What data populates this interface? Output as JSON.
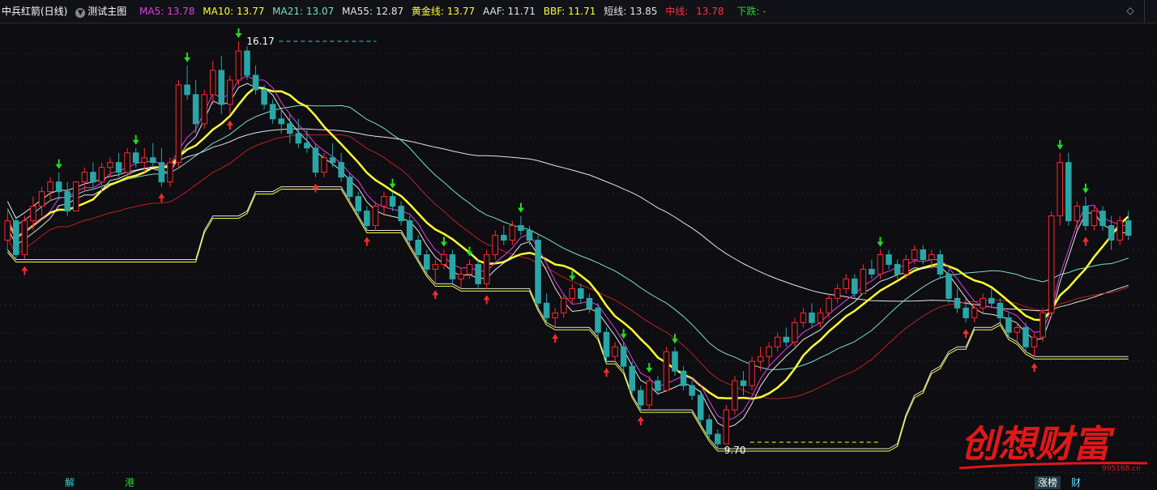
{
  "header": {
    "stock": "中兵红箭(日线)",
    "template": "测试主图",
    "ma5": "MA5: 13.78",
    "ma10": "MA10: 13.77",
    "ma21": "MA21: 13.07",
    "ma55": "MA55: 12.87",
    "gold": "黄金线: 13.77",
    "aaf": "AAF: 11.71",
    "bbf": "BBF: 11.71",
    "short": "短线: 13.85",
    "mid_label": "中线:",
    "mid_val": "13.78",
    "fall": "下跌: -"
  },
  "footer": {
    "left1": "解",
    "left2": "港",
    "tab1": "涨榜",
    "tab2": "财"
  },
  "logo": {
    "text": "创想财富",
    "url": "995168.cn"
  },
  "colors": {
    "bg": "#0d0d12",
    "up": "#ff2a2a",
    "down": "#2aa6a6",
    "yellow": "#ffff33",
    "white": "#e6e6e6",
    "aqua": "#7fe0c0",
    "magenta": "#e040e0",
    "darkred": "#c02020",
    "green": "#22dd22",
    "orange": "#ff9933",
    "pink": "#ff3388",
    "cyanlabel": "#44cccc"
  },
  "chart_data": {
    "type": "candlestick",
    "price_labels": {
      "high": "16.17",
      "low": "9.70"
    },
    "candles": [
      [
        14.0,
        14.6,
        13.8,
        14.4
      ],
      [
        14.4,
        14.5,
        13.6,
        13.7
      ],
      [
        13.7,
        14.5,
        13.6,
        14.4
      ],
      [
        14.4,
        14.9,
        14.2,
        14.7
      ],
      [
        14.7,
        15.1,
        14.5,
        15.0
      ],
      [
        15.0,
        15.3,
        14.8,
        15.2
      ],
      [
        15.2,
        15.4,
        14.9,
        15.0
      ],
      [
        15.0,
        15.2,
        14.5,
        14.6
      ],
      [
        14.6,
        15.2,
        14.6,
        15.2
      ],
      [
        15.2,
        15.5,
        15.0,
        15.4
      ],
      [
        15.4,
        15.6,
        15.1,
        15.2
      ],
      [
        15.2,
        15.6,
        15.0,
        15.5
      ],
      [
        15.5,
        15.7,
        15.3,
        15.6
      ],
      [
        15.6,
        15.8,
        15.3,
        15.4
      ],
      [
        15.4,
        15.9,
        15.3,
        15.8
      ],
      [
        15.8,
        15.9,
        15.5,
        15.6
      ],
      [
        15.6,
        15.9,
        15.4,
        15.7
      ],
      [
        15.7,
        16.0,
        15.5,
        15.6
      ],
      [
        15.6,
        15.9,
        15.1,
        15.2
      ],
      [
        15.2,
        15.7,
        15.1,
        15.6
      ],
      [
        15.6,
        17.3,
        15.5,
        17.2
      ],
      [
        17.2,
        17.6,
        16.9,
        17.0
      ],
      [
        17.0,
        17.3,
        16.2,
        16.4
      ],
      [
        16.4,
        17.1,
        16.3,
        17.0
      ],
      [
        17.0,
        17.7,
        16.8,
        17.5
      ],
      [
        17.5,
        17.8,
        16.6,
        16.8
      ],
      [
        16.8,
        17.4,
        16.6,
        17.3
      ],
      [
        17.3,
        18.1,
        17.2,
        17.9
      ],
      [
        17.9,
        18.0,
        17.3,
        17.4
      ],
      [
        17.4,
        17.6,
        17.0,
        17.1
      ],
      [
        17.1,
        17.2,
        16.7,
        16.8
      ],
      [
        16.8,
        16.9,
        16.4,
        16.5
      ],
      [
        16.5,
        16.7,
        16.2,
        16.4
      ],
      [
        16.4,
        16.6,
        16.0,
        16.2
      ],
      [
        16.2,
        16.5,
        15.9,
        16.0
      ],
      [
        16.0,
        16.3,
        15.8,
        15.9
      ],
      [
        15.9,
        16.0,
        15.3,
        15.4
      ],
      [
        15.4,
        15.8,
        15.3,
        15.7
      ],
      [
        15.7,
        16.0,
        15.5,
        15.6
      ],
      [
        15.6,
        15.8,
        15.2,
        15.3
      ],
      [
        15.3,
        15.4,
        14.8,
        14.9
      ],
      [
        14.9,
        15.0,
        14.5,
        14.6
      ],
      [
        14.6,
        14.7,
        14.2,
        14.3
      ],
      [
        14.3,
        14.8,
        14.2,
        14.7
      ],
      [
        14.7,
        15.0,
        14.5,
        14.9
      ],
      [
        14.9,
        15.0,
        14.6,
        14.7
      ],
      [
        14.7,
        14.8,
        14.3,
        14.4
      ],
      [
        14.4,
        14.5,
        13.9,
        14.0
      ],
      [
        14.0,
        14.1,
        13.6,
        13.7
      ],
      [
        13.7,
        13.8,
        13.3,
        13.4
      ],
      [
        13.4,
        13.6,
        13.1,
        13.5
      ],
      [
        13.5,
        13.8,
        13.4,
        13.7
      ],
      [
        13.7,
        13.8,
        13.1,
        13.2
      ],
      [
        13.2,
        13.4,
        13.0,
        13.3
      ],
      [
        13.3,
        13.6,
        13.2,
        13.5
      ],
      [
        13.5,
        13.6,
        13.0,
        13.1
      ],
      [
        13.1,
        13.8,
        13.0,
        13.7
      ],
      [
        13.7,
        14.2,
        13.6,
        14.1
      ],
      [
        14.1,
        14.3,
        13.9,
        14.0
      ],
      [
        14.0,
        14.4,
        13.9,
        14.3
      ],
      [
        14.3,
        14.5,
        14.1,
        14.2
      ],
      [
        14.2,
        14.3,
        13.9,
        14.0
      ],
      [
        14.0,
        14.1,
        12.6,
        12.7
      ],
      [
        12.7,
        12.9,
        12.3,
        12.4
      ],
      [
        12.4,
        12.6,
        12.2,
        12.5
      ],
      [
        12.5,
        12.9,
        12.4,
        12.8
      ],
      [
        12.8,
        13.1,
        12.7,
        13.0
      ],
      [
        13.0,
        13.1,
        12.7,
        12.8
      ],
      [
        12.8,
        12.9,
        12.5,
        12.6
      ],
      [
        12.6,
        12.7,
        12.0,
        12.1
      ],
      [
        12.1,
        12.2,
        11.5,
        11.6
      ],
      [
        11.6,
        11.9,
        11.5,
        11.8
      ],
      [
        11.8,
        11.9,
        11.3,
        11.4
      ],
      [
        11.4,
        11.5,
        10.8,
        10.9
      ],
      [
        10.9,
        11.0,
        10.5,
        10.6
      ],
      [
        10.6,
        11.2,
        10.5,
        11.1
      ],
      [
        11.1,
        11.2,
        10.8,
        10.9
      ],
      [
        10.9,
        11.8,
        10.9,
        11.7
      ],
      [
        11.7,
        11.8,
        11.2,
        11.3
      ],
      [
        11.3,
        11.4,
        10.9,
        11.0
      ],
      [
        11.0,
        11.1,
        10.7,
        10.8
      ],
      [
        10.8,
        10.9,
        10.2,
        10.3
      ],
      [
        10.3,
        10.4,
        9.9,
        10.0
      ],
      [
        10.0,
        10.1,
        9.7,
        9.8
      ],
      [
        9.8,
        10.6,
        9.8,
        10.5
      ],
      [
        10.5,
        11.2,
        10.4,
        11.1
      ],
      [
        11.1,
        11.3,
        10.8,
        11.0
      ],
      [
        11.0,
        11.6,
        10.9,
        11.5
      ],
      [
        11.5,
        11.8,
        11.3,
        11.6
      ],
      [
        11.6,
        11.9,
        11.4,
        11.8
      ],
      [
        11.8,
        12.1,
        11.7,
        12.0
      ],
      [
        12.0,
        12.2,
        11.8,
        11.9
      ],
      [
        11.9,
        12.4,
        11.8,
        12.3
      ],
      [
        12.3,
        12.6,
        12.2,
        12.5
      ],
      [
        12.5,
        12.7,
        12.2,
        12.3
      ],
      [
        12.3,
        12.6,
        12.2,
        12.5
      ],
      [
        12.5,
        12.9,
        12.4,
        12.8
      ],
      [
        12.8,
        13.1,
        12.7,
        13.0
      ],
      [
        13.0,
        13.3,
        12.9,
        13.2
      ],
      [
        13.2,
        13.3,
        12.8,
        12.9
      ],
      [
        12.9,
        13.5,
        12.9,
        13.4
      ],
      [
        13.4,
        13.6,
        13.2,
        13.3
      ],
      [
        13.3,
        13.8,
        13.2,
        13.7
      ],
      [
        13.7,
        13.8,
        13.4,
        13.5
      ],
      [
        13.5,
        13.6,
        13.2,
        13.3
      ],
      [
        13.3,
        13.7,
        13.2,
        13.6
      ],
      [
        13.6,
        13.9,
        13.5,
        13.8
      ],
      [
        13.8,
        13.9,
        13.5,
        13.6
      ],
      [
        13.6,
        13.8,
        13.4,
        13.7
      ],
      [
        13.7,
        13.8,
        13.2,
        13.3
      ],
      [
        13.3,
        13.4,
        12.7,
        12.8
      ],
      [
        12.8,
        13.0,
        12.5,
        12.6
      ],
      [
        12.6,
        12.8,
        12.3,
        12.4
      ],
      [
        12.4,
        12.7,
        12.3,
        12.6
      ],
      [
        12.6,
        12.9,
        12.5,
        12.8
      ],
      [
        12.8,
        13.0,
        12.6,
        12.7
      ],
      [
        12.7,
        12.8,
        12.3,
        12.4
      ],
      [
        12.4,
        12.5,
        12.0,
        12.1
      ],
      [
        12.1,
        12.3,
        11.9,
        12.2
      ],
      [
        12.2,
        12.3,
        11.7,
        11.8
      ],
      [
        11.8,
        12.1,
        11.6,
        12.0
      ],
      [
        12.0,
        12.6,
        11.9,
        12.5
      ],
      [
        12.5,
        14.6,
        12.4,
        14.5
      ],
      [
        14.5,
        15.8,
        14.3,
        15.6
      ],
      [
        15.6,
        15.8,
        14.3,
        14.4
      ],
      [
        14.4,
        14.8,
        14.2,
        14.7
      ],
      [
        14.7,
        14.9,
        14.2,
        14.3
      ],
      [
        14.3,
        14.7,
        14.2,
        14.6
      ],
      [
        14.6,
        14.7,
        14.2,
        14.3
      ],
      [
        14.3,
        14.5,
        13.8,
        14.0
      ],
      [
        14.0,
        14.5,
        13.9,
        14.4
      ],
      [
        14.4,
        14.6,
        14.0,
        14.1
      ]
    ]
  }
}
